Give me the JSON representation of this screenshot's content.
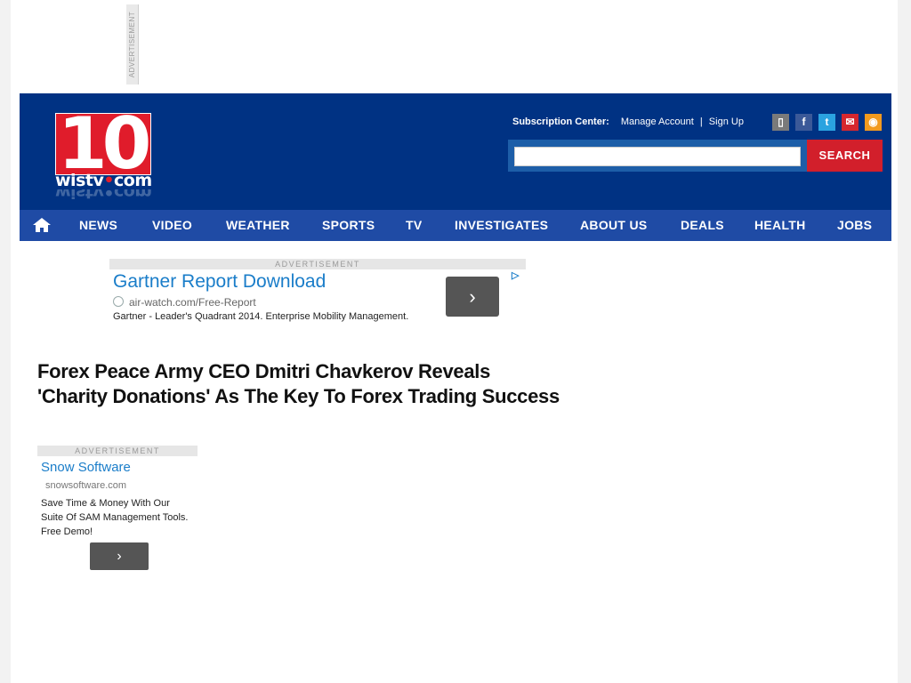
{
  "top_ad": {
    "label": "ADVERTISEMENT"
  },
  "header": {
    "logo": {
      "number": "10",
      "site_prefix": "wistv",
      "site_dot": "•",
      "site_suffix": "com"
    },
    "subscription": {
      "label": "Subscription Center:",
      "manage_account": "Manage Account",
      "separator": "|",
      "sign_up": "Sign Up"
    },
    "social": [
      {
        "name": "mobile-icon",
        "glyph": "▯",
        "color": "#7a7a7a"
      },
      {
        "name": "facebook-icon",
        "glyph": "f",
        "color": "#3b5998"
      },
      {
        "name": "twitter-icon",
        "glyph": "t",
        "color": "#2aa3e0"
      },
      {
        "name": "email-icon",
        "glyph": "✉",
        "color": "#d6272e"
      },
      {
        "name": "rss-icon",
        "glyph": "◉",
        "color": "#f29a1e"
      }
    ],
    "search": {
      "placeholder": "",
      "button_label": "SEARCH"
    }
  },
  "nav": {
    "home_icon": "home-icon",
    "items": [
      "NEWS",
      "VIDEO",
      "WEATHER",
      "SPORTS",
      "TV",
      "INVESTIGATES",
      "ABOUT US",
      "DEALS",
      "HEALTH",
      "JOBS"
    ]
  },
  "ad1": {
    "label": "ADVERTISEMENT",
    "title": "Gartner Report Download",
    "url": "air-watch.com/Free-Report",
    "description": "Gartner - Leader's Quadrant 2014. Enterprise Mobility Management.",
    "button_glyph": "›",
    "choice_glyph": "▷"
  },
  "article": {
    "headline": "Forex Peace Army CEO Dmitri Chavkerov Reveals 'Charity Donations' As The Key To Forex Trading Success"
  },
  "ad2": {
    "label": "ADVERTISEMENT",
    "title": "Snow Software",
    "url": "snowsoftware.com",
    "description": "Save Time & Money With Our Suite Of SAM Management Tools. Free Demo!",
    "button_glyph": "›"
  },
  "colors": {
    "header_bg": "#003283",
    "nav_bg": "#1f4ba5",
    "accent_red": "#d21f2b",
    "ad_link": "#1a7dc9"
  }
}
